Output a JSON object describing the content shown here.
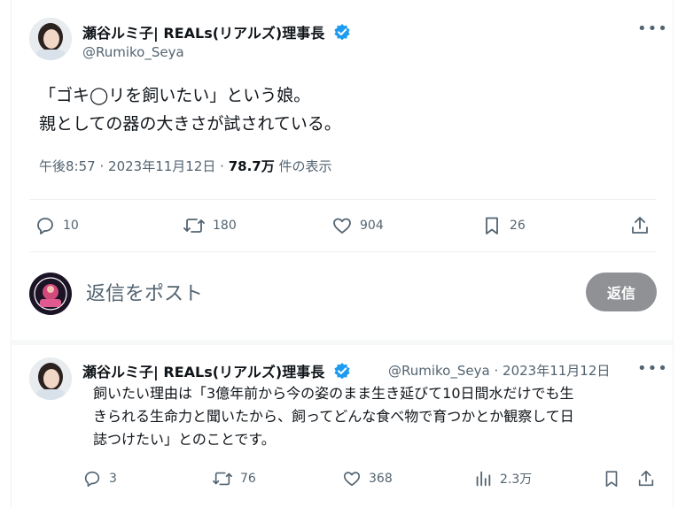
{
  "main_tweet": {
    "author_name": "瀬谷ルミ子| REALs(リアルズ)理事長",
    "handle": "@Rumiko_Seya",
    "text_lines": [
      "「ゴキ◯リを飼いたい」という娘。",
      "親としての器の大きさが試されている。"
    ],
    "time": "午後8:57",
    "date": "2023年11月12日",
    "views_count": "78.7万",
    "views_label": "件の表示",
    "sep": "·",
    "actions": {
      "replies": "10",
      "reposts": "180",
      "likes": "904",
      "bookmarks": "26"
    }
  },
  "compose": {
    "placeholder": "返信をポスト",
    "button_label": "返信"
  },
  "reply_tweet": {
    "author_name": "瀬谷ルミ子| REALs(リアルズ)理事長",
    "handle": "@Rumiko_Seya",
    "sep": "·",
    "date": "2023年11月12日",
    "text_lines": [
      "飼いたい理由は「3億年前から今の姿のまま生き延びて10日間水だけでも生",
      "きられる生命力と聞いたから、飼ってどんな食べ物で育つかとか観察して日",
      "誌つけたい」とのことです。"
    ],
    "actions": {
      "replies": "3",
      "reposts": "76",
      "likes": "368",
      "views": "2.3万"
    }
  },
  "icons": [
    "verified-badge-icon",
    "more-icon",
    "reply-icon",
    "repost-icon",
    "like-icon",
    "bookmark-icon",
    "share-icon",
    "views-icon"
  ],
  "colors": {
    "verified": "#1d9bf0",
    "text": "#0f1419",
    "muted": "#536471",
    "reply_button": "#8f9194"
  }
}
